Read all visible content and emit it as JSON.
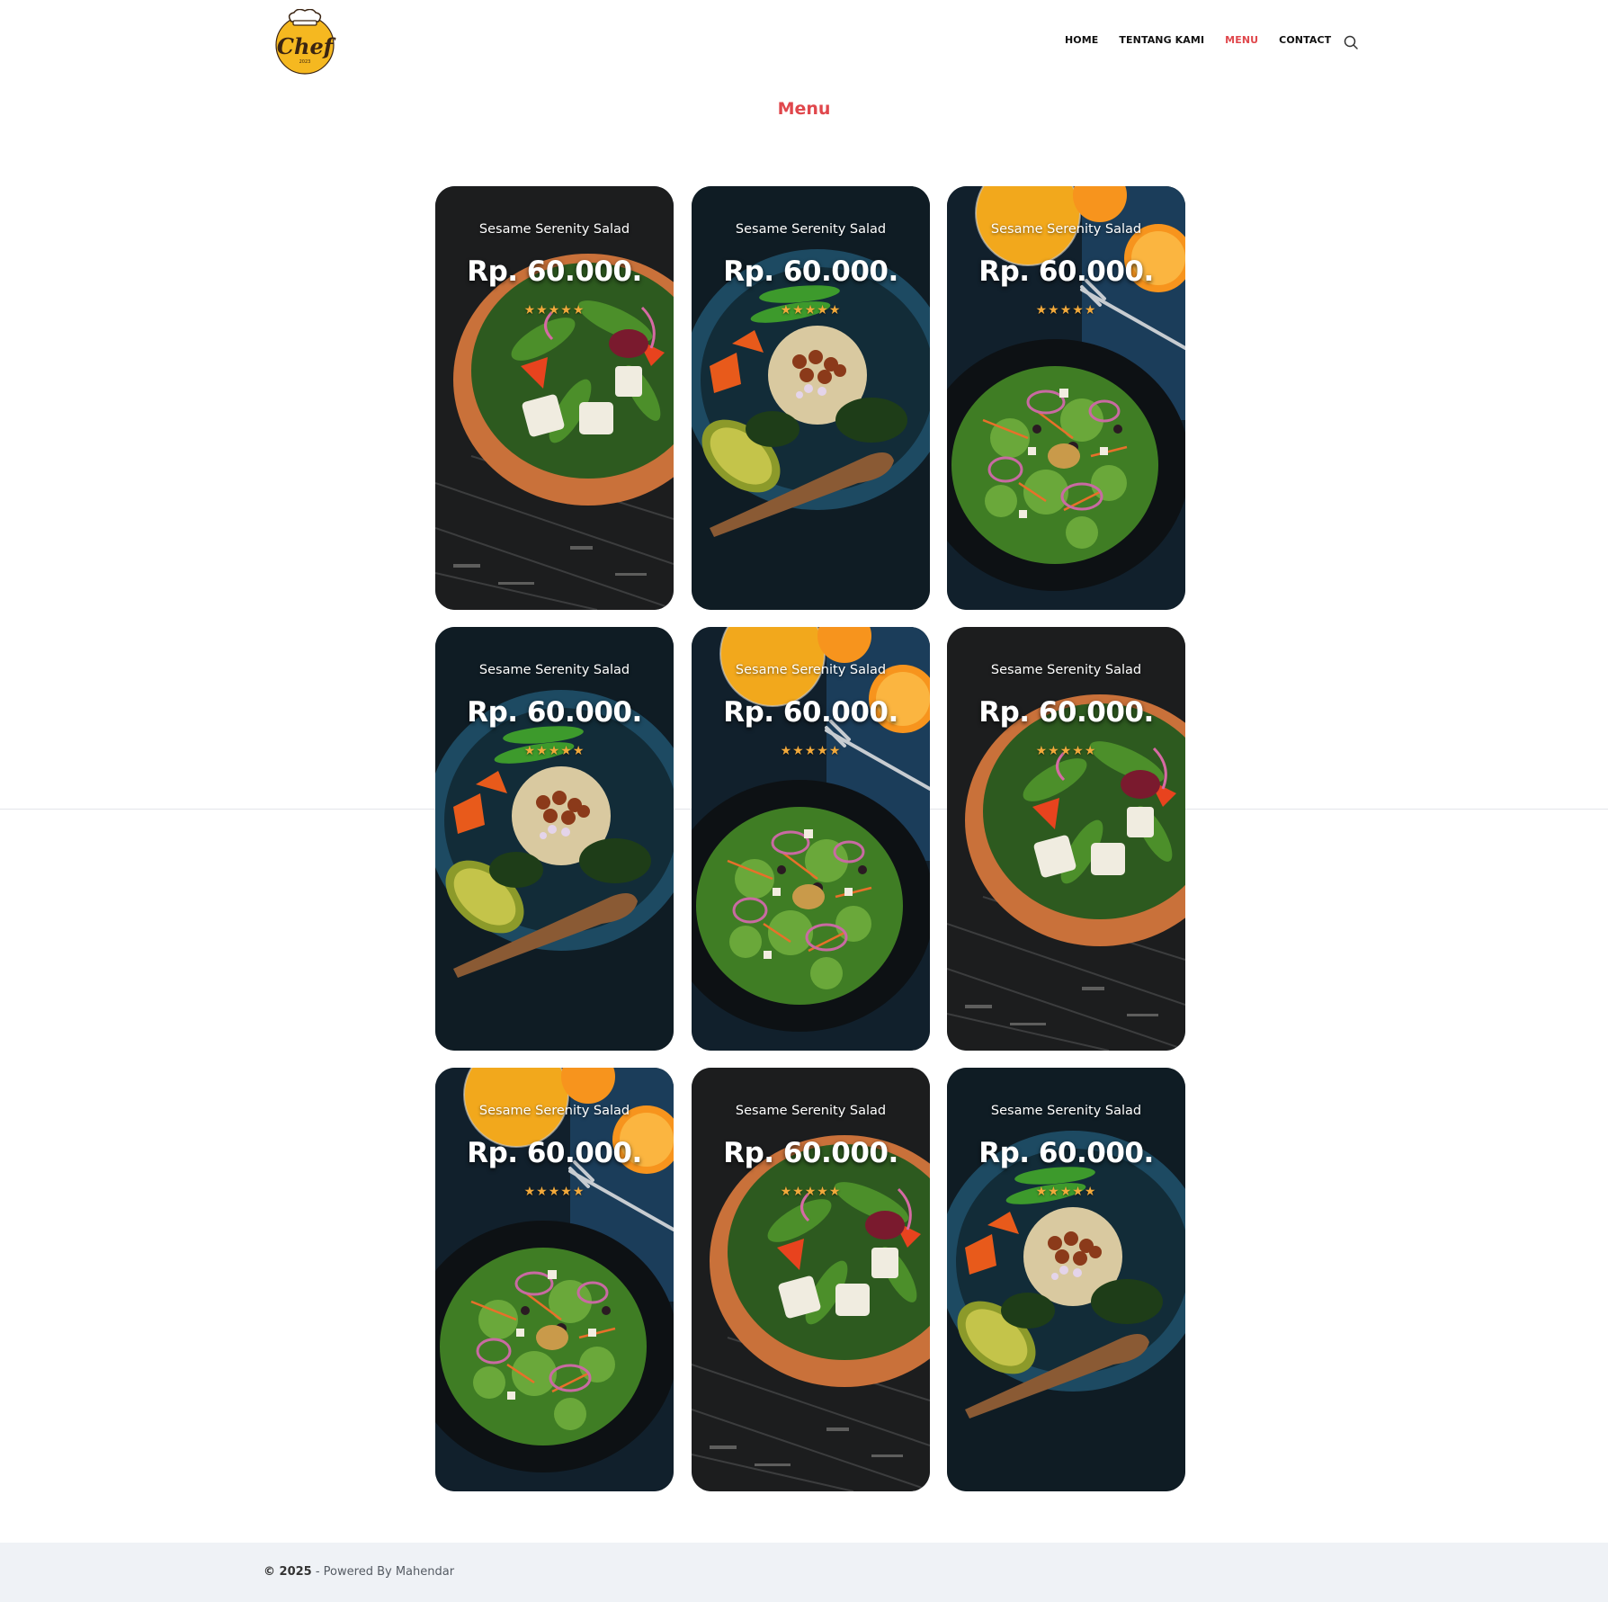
{
  "brand": {
    "logo_text": "Chef",
    "logo_year": "2023",
    "logo_icon": "chef-hat-icon"
  },
  "nav": {
    "items": [
      {
        "label": "HOME",
        "active": false
      },
      {
        "label": "TENTANG KAMI",
        "active": false
      },
      {
        "label": "MENU",
        "active": true
      },
      {
        "label": "CONTACT",
        "active": false
      }
    ],
    "search_icon": "search-icon"
  },
  "page": {
    "title": "Menu"
  },
  "menu_items": [
    {
      "name": "Sesame Serenity Salad",
      "price": "Rp. 60.000.",
      "rating": 5,
      "photo": "wooden-bowl-salad"
    },
    {
      "name": "Sesame Serenity Salad",
      "price": "Rp. 60.000.",
      "rating": 5,
      "photo": "blue-bowl-quinoa"
    },
    {
      "name": "Sesame Serenity Salad",
      "price": "Rp. 60.000.",
      "rating": 5,
      "photo": "dark-plate-salad-orange-juice"
    },
    {
      "name": "Sesame Serenity Salad",
      "price": "Rp. 60.000.",
      "rating": 5,
      "photo": "blue-bowl-quinoa"
    },
    {
      "name": "Sesame Serenity Salad",
      "price": "Rp. 60.000.",
      "rating": 5,
      "photo": "dark-plate-salad-orange-juice"
    },
    {
      "name": "Sesame Serenity Salad",
      "price": "Rp. 60.000.",
      "rating": 5,
      "photo": "wooden-bowl-salad"
    },
    {
      "name": "Sesame Serenity Salad",
      "price": "Rp. 60.000.",
      "rating": 5,
      "photo": "dark-plate-salad-orange-juice"
    },
    {
      "name": "Sesame Serenity Salad",
      "price": "Rp. 60.000.",
      "rating": 5,
      "photo": "wooden-bowl-salad"
    },
    {
      "name": "Sesame Serenity Salad",
      "price": "Rp. 60.000.",
      "rating": 5,
      "photo": "blue-bowl-quinoa"
    }
  ],
  "footer": {
    "year": "© 2025",
    "text": " - Powered By Mahendar"
  },
  "colors": {
    "accent": "#e0474c",
    "star": "#f2a93b",
    "footer_bg": "#eff2f6"
  }
}
